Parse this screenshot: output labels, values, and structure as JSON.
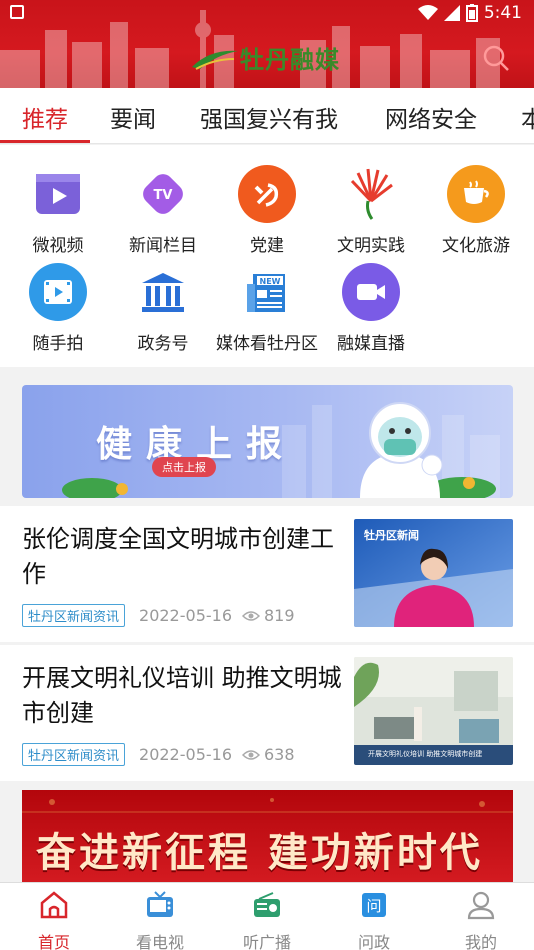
{
  "status": {
    "time": "5:41"
  },
  "header": {
    "app_name": "牡丹融媒"
  },
  "tabs": [
    {
      "label": "推荐",
      "active": true
    },
    {
      "label": "要闻"
    },
    {
      "label": "强国复兴有我"
    },
    {
      "label": "网络安全"
    },
    {
      "label": "本"
    }
  ],
  "grid": [
    {
      "label": "微视频",
      "icon": "video-play-icon",
      "color": "#7b61d9"
    },
    {
      "label": "新闻栏目",
      "icon": "tv-icon",
      "color": "#a35ce6"
    },
    {
      "label": "党建",
      "icon": "party-emblem-icon",
      "color": "#f05a1e"
    },
    {
      "label": "文明实践",
      "icon": "civilization-fan-icon",
      "color": "#e63c2e"
    },
    {
      "label": "文化旅游",
      "icon": "coffee-cup-icon",
      "color": "#f59a1c"
    },
    {
      "label": "随手拍",
      "icon": "film-clip-icon",
      "color": "#2f9ae8"
    },
    {
      "label": "政务号",
      "icon": "government-building-icon",
      "color": "#2a6fd6"
    },
    {
      "label": "媒体看牡丹区",
      "icon": "newspaper-new-icon",
      "color": "#2a7fd6"
    },
    {
      "label": "融媒直播",
      "icon": "live-camera-icon",
      "color": "#7a5be6"
    }
  ],
  "banner": {
    "title": "健康上报",
    "button": "点击上报"
  },
  "news": [
    {
      "title": "张伦调度全国文明城市创建工作",
      "tag": "牡丹区新闻资讯",
      "date": "2022-05-16",
      "views": "819",
      "thumb_caption": "牡丹区新闻"
    },
    {
      "title": "开展文明礼仪培训 助推文明城市创建",
      "tag": "牡丹区新闻资讯",
      "date": "2022-05-16",
      "views": "638",
      "thumb_caption": "开展文明礼仪培训 助推文明城市创建"
    }
  ],
  "poster": {
    "text": "奋进新征程 建功新时代"
  },
  "bottom_nav": [
    {
      "label": "首页",
      "icon": "home-icon",
      "active": true
    },
    {
      "label": "看电视",
      "icon": "television-icon"
    },
    {
      "label": "听广播",
      "icon": "radio-icon"
    },
    {
      "label": "问政",
      "icon": "ask-government-icon"
    },
    {
      "label": "我的",
      "icon": "user-profile-icon"
    }
  ],
  "colors": {
    "brand_red": "#d8262b",
    "tag_blue": "#2e8dc9"
  }
}
